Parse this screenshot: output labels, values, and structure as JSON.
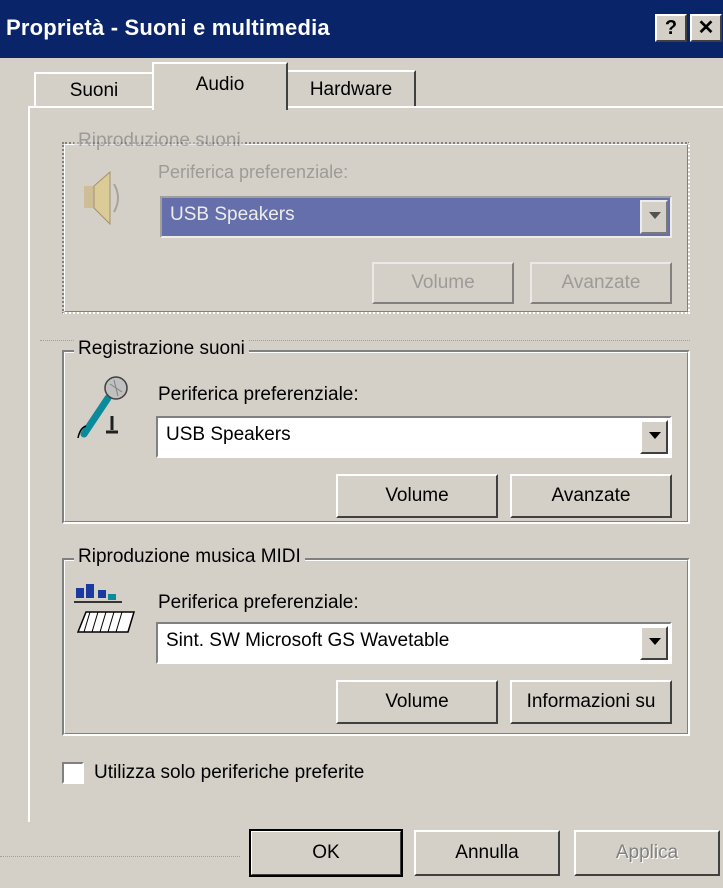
{
  "window": {
    "title": "Proprietà - Suoni e multimedia",
    "help_label": "?",
    "close_label": "✕"
  },
  "tabs": [
    {
      "label": "Suoni"
    },
    {
      "label": "Audio"
    },
    {
      "label": "Hardware"
    }
  ],
  "playback_group": {
    "legend": "Riproduzione suoni",
    "device_label": "Periferica preferenziale:",
    "device_value": "USB Speakers",
    "volume_label": "Volume",
    "advanced_label": "Avanzate"
  },
  "record_group": {
    "legend": "Registrazione suoni",
    "device_label": "Periferica preferenziale:",
    "device_value": "USB Speakers",
    "volume_label": "Volume",
    "advanced_label": "Avanzate"
  },
  "midi_group": {
    "legend": "Riproduzione musica MIDI",
    "device_label": "Periferica preferenziale:",
    "device_value": "Sint. SW Microsoft GS Wavetable",
    "volume_label": "Volume",
    "about_label": "Informazioni su"
  },
  "preferred_only": {
    "label": "Utilizza solo periferiche preferite",
    "checked": false
  },
  "footer": {
    "ok_label": "OK",
    "cancel_label": "Annulla",
    "apply_label": "Applica"
  },
  "icons": {
    "speaker": "speaker-icon",
    "microphone": "microphone-icon",
    "midi": "midi-keyboard-icon"
  }
}
